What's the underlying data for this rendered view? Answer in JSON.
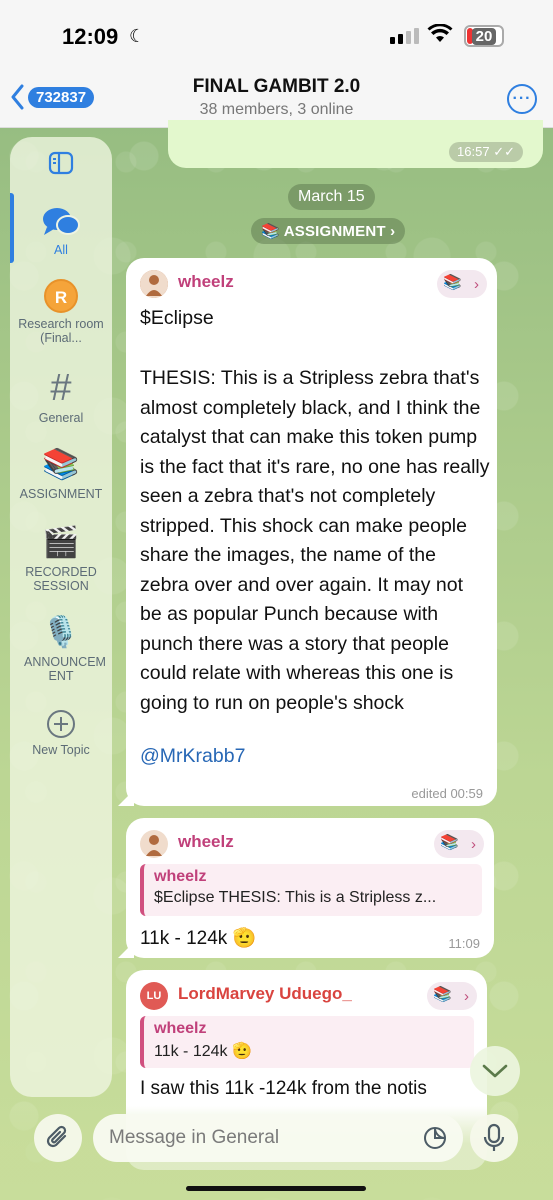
{
  "status_bar": {
    "time": "12:09",
    "battery": "20"
  },
  "header": {
    "back_badge": "732837",
    "title": "FINAL GAMBIT 2.0",
    "subtitle": "38 members, 3 online"
  },
  "sidebar": {
    "items": [
      {
        "label": "All"
      },
      {
        "label": "Research room (Final...",
        "avatar_letter": "R"
      },
      {
        "label": "General"
      },
      {
        "label": "ASSIGNMENT"
      },
      {
        "label": "RECORDED SESSION"
      },
      {
        "label": "ANNOUNCEM ENT"
      },
      {
        "label": "New Topic"
      }
    ]
  },
  "chat": {
    "top_message_time": "16:57",
    "date_separator": "March 15",
    "topic_chip": "ASSIGNMENT",
    "messages": [
      {
        "sender": "wheelz",
        "ticker": "$Eclipse",
        "body": "THESIS: This is a Stripless zebra that's almost completely black, and I think the catalyst that can make this token pump is the fact that it's rare, no one has really seen a zebra that's not completely stripped. This shock can make people share the images, the name of the zebra over and over again. It may not be as popular Punch because with punch there was a story that people could relate with whereas this one is going to run on people's shock",
        "mention": "@MrKrabb7",
        "meta": "edited 00:59"
      },
      {
        "sender": "wheelz",
        "reply_name": "wheelz",
        "reply_text": "$Eclipse THESIS: This is a Stripless z...",
        "body": "11k - 124k",
        "emoji": "🫡",
        "meta": "11:09"
      },
      {
        "sender": "LordMarvey Uduego_",
        "avatar_initials": "LU",
        "reply_name": "wheelz",
        "reply_text": "11k - 124k",
        "reply_emoji": "🫡",
        "body": "I saw this 11k -124k from the notis"
      }
    ]
  },
  "composer": {
    "placeholder": "Message in General"
  },
  "colors": {
    "accent": "#2f7fe0",
    "sender_pink": "#c0407a",
    "sender_red": "#d9443f",
    "own_bubble": "#e3f8cd"
  }
}
